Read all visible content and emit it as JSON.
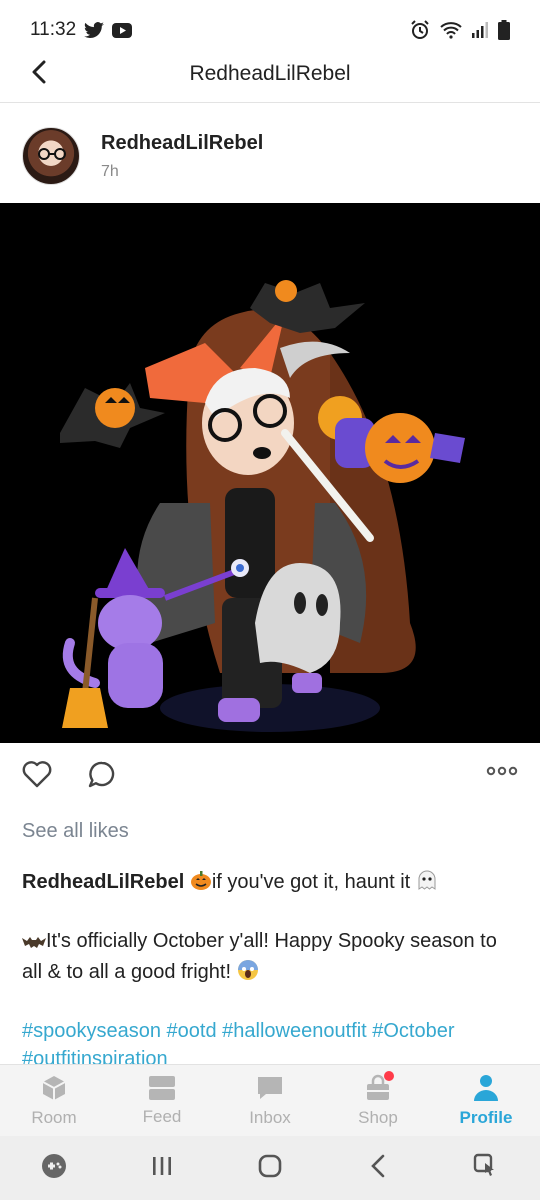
{
  "status_bar": {
    "time": "11:32",
    "icons": [
      "twitter-icon",
      "youtube-icon",
      "alarm-icon",
      "wifi-icon",
      "signal-icon",
      "battery-icon"
    ]
  },
  "header": {
    "title": "RedheadLilRebel",
    "back_icon": "chevron-left-icon"
  },
  "post": {
    "author": "RedheadLilRebel",
    "time": "7h",
    "image_description_icon": "avatar-halloween-outfit",
    "actions": {
      "like_icon": "heart-icon",
      "comment_icon": "comment-icon",
      "more_icon": "more-dots-icon"
    },
    "see_likes": "See all likes",
    "caption": {
      "user": "RedheadLilRebel",
      "line1": "if you've got it, haunt it",
      "line2": "It's officially October y'all! Happy Spooky season to all & to all a good fright!",
      "tags": "#spookyseason #ootd #halloweenoutfit #October #outfitinspiration"
    }
  },
  "bottom_nav": {
    "items": [
      {
        "label": "Room",
        "icon": "room-cube-icon",
        "active": false
      },
      {
        "label": "Feed",
        "icon": "feed-icon",
        "active": false
      },
      {
        "label": "Inbox",
        "icon": "chat-bubble-icon",
        "active": false
      },
      {
        "label": "Shop",
        "icon": "shopping-bag-icon",
        "active": false
      },
      {
        "label": "Profile",
        "icon": "person-icon",
        "active": true
      }
    ]
  },
  "colors": {
    "accent": "#2aa6d8",
    "hashtag": "#36a8cf",
    "notification_dot": "#ff3b49",
    "muted": "#7b8591"
  }
}
